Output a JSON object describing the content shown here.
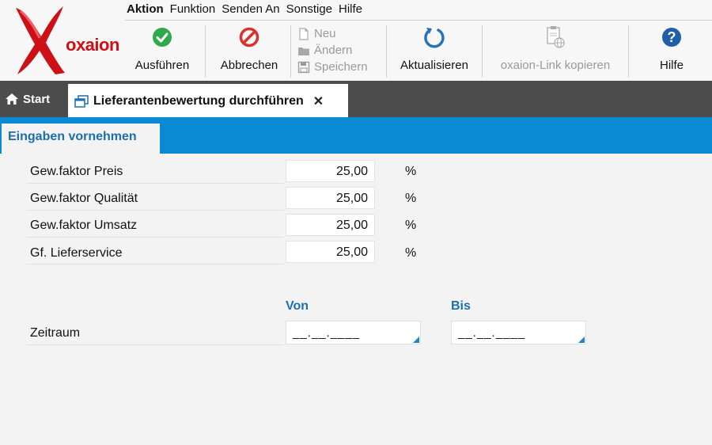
{
  "app": {
    "logo_text": "oxaion"
  },
  "menu": [
    "Aktion",
    "Funktion",
    "Senden An",
    "Sonstige",
    "Hilfe"
  ],
  "toolbar": {
    "execute": "Ausführen",
    "cancel": "Abbrechen",
    "new": "Neu",
    "change": "Ändern",
    "save": "Speichern",
    "refresh": "Aktualisieren",
    "copy_link": "oxaion-Link kopieren",
    "help": "Hilfe"
  },
  "tabs": {
    "start": "Start",
    "active": "Lieferantenbewertung durchführen",
    "close": "✕"
  },
  "section": {
    "title": "Eingaben vornehmen"
  },
  "form": {
    "fields": [
      {
        "label": "Gew.faktor Preis",
        "value": "25,00",
        "unit": "%"
      },
      {
        "label": "Gew.faktor Qualität",
        "value": "25,00",
        "unit": "%"
      },
      {
        "label": "Gew.faktor Umsatz",
        "value": "25,00",
        "unit": "%"
      },
      {
        "label": "Gf. Lieferservice",
        "value": "25,00",
        "unit": "%"
      }
    ],
    "period": {
      "label": "Zeitraum",
      "from_label": "Von",
      "to_label": "Bis",
      "from_value": "__.__.____",
      "to_value": "__.__.____"
    }
  },
  "colors": {
    "accent": "#0a8ad3",
    "tabbar": "#4c4c4c",
    "brand": "#cc1016",
    "ok": "#2eaa4a",
    "cancel": "#d9322a"
  }
}
